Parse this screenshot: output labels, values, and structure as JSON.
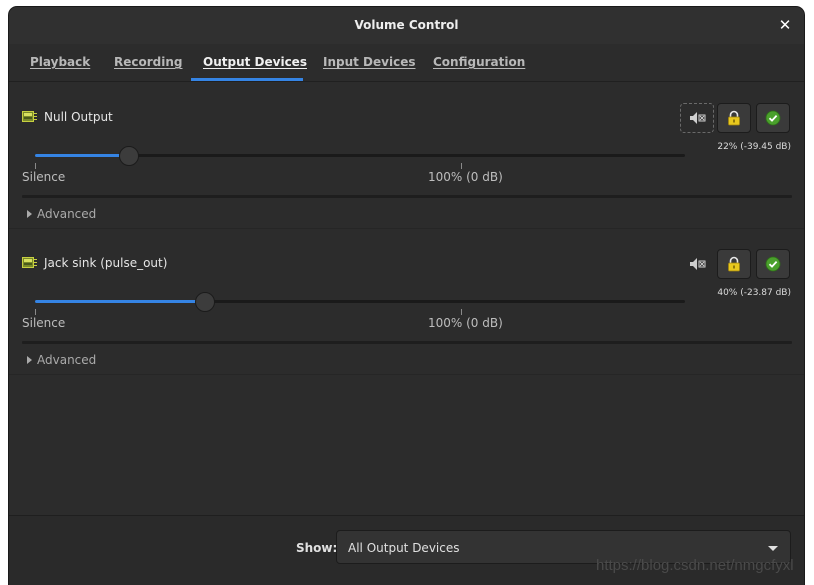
{
  "window": {
    "title": "Volume Control"
  },
  "tabs": [
    {
      "label": "Playback",
      "active": false
    },
    {
      "label": "Recording",
      "active": false
    },
    {
      "label": "Output Devices",
      "active": true
    },
    {
      "label": "Input Devices",
      "active": false
    },
    {
      "label": "Configuration",
      "active": false
    }
  ],
  "devices": [
    {
      "name": "Null Output",
      "volume_percent": 22,
      "volume_readout": "22% (-39.45 dB)",
      "scale_min_label": "Silence",
      "scale_mid_label": "100% (0 dB)",
      "advanced_label": "Advanced",
      "icons": {
        "mute": "speaker-muted-icon",
        "lock": "lock-icon",
        "default": "checkmark-icon"
      }
    },
    {
      "name": "Jack sink (pulse_out)",
      "volume_percent": 40,
      "volume_readout": "40% (-23.87 dB)",
      "scale_min_label": "Silence",
      "scale_mid_label": "100% (0 dB)",
      "advanced_label": "Advanced",
      "icons": {
        "mute": "speaker-muted-icon",
        "lock": "lock-icon",
        "default": "checkmark-icon"
      }
    }
  ],
  "footer": {
    "show_label": "Show:",
    "show_value": "All Output Devices"
  },
  "watermark": "https://blog.csdn.net/nmgcfyxl",
  "colors": {
    "accent": "#3584e4",
    "background": "#2c2c2c",
    "lock_yellow": "#e8c81e",
    "check_green": "#4aa02c"
  }
}
